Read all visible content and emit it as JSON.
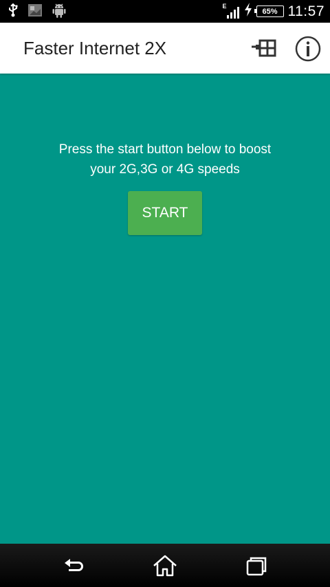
{
  "status_bar": {
    "network_type": "E",
    "battery_percent": "65%",
    "time": "11:57"
  },
  "app_bar": {
    "title": "Faster Internet 2X"
  },
  "main": {
    "instruction_line1": "Press the start button below to boost",
    "instruction_line2": "your 2G,3G or 4G speeds",
    "start_label": "START"
  },
  "colors": {
    "primary_teal": "#009688",
    "start_green": "#4CAF50",
    "app_bar_bg": "#ffffff"
  },
  "icons": {
    "status_left": [
      "usb-icon",
      "image-icon",
      "android-icon"
    ],
    "status_right": [
      "signal-icon",
      "charging-icon",
      "battery-icon"
    ],
    "app_bar": [
      "grid-icon",
      "info-icon"
    ],
    "nav_bar": [
      "back-icon",
      "home-icon",
      "recent-apps-icon"
    ]
  }
}
